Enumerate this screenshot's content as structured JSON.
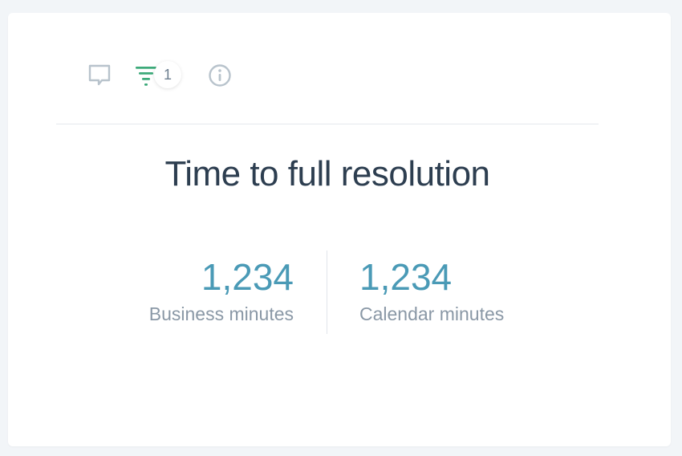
{
  "toolbar": {
    "comment_icon": "comment-icon",
    "filter_icon": "filter-icon",
    "filter_count": "1",
    "info_icon": "info-icon"
  },
  "card": {
    "title": "Time to full resolution",
    "metrics": [
      {
        "value": "1,234",
        "label": "Business minutes"
      },
      {
        "value": "1,234",
        "label": "Calendar minutes"
      }
    ]
  },
  "colors": {
    "accent": "#4a9ab6",
    "filter": "#3daa7a",
    "icon_gray": "#b8c3cc",
    "title": "#2d3e50"
  }
}
